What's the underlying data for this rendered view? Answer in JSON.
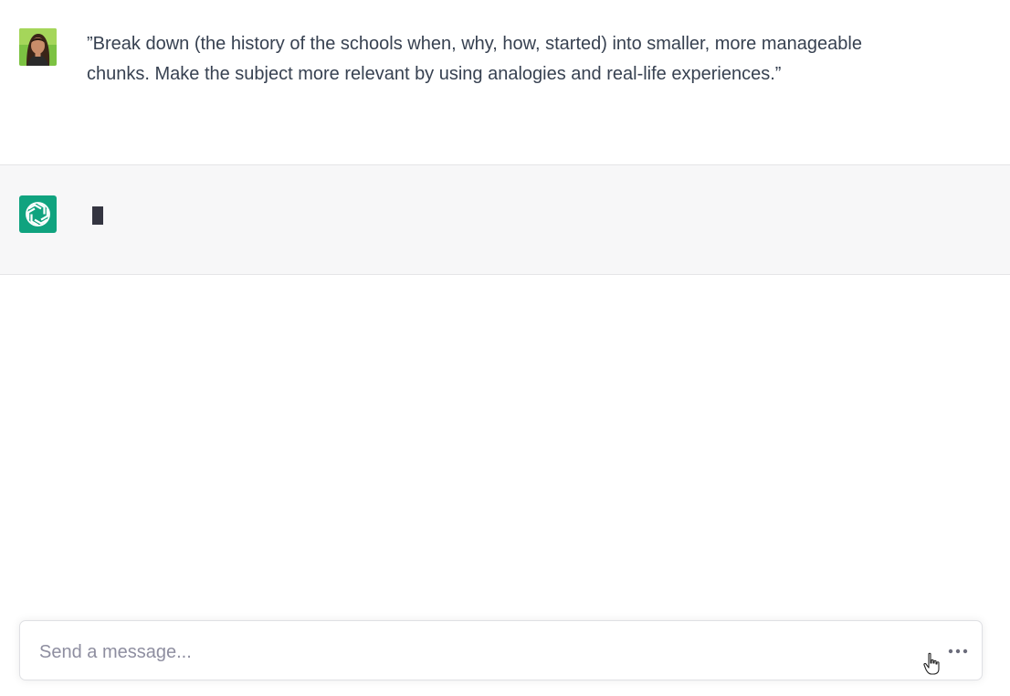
{
  "conversation": {
    "user_message": {
      "text": "”Break down (the history of the schools when, why, how, started) into smaller, more manageable chunks. Make the subject more relevant by using analogies and real-life experiences.”",
      "avatar_icon": "user-avatar-photo"
    },
    "assistant_message": {
      "text": "",
      "avatar_icon": "openai-logo-icon",
      "state": "typing-cursor"
    }
  },
  "composer": {
    "placeholder": "Send a message...",
    "value": "",
    "more_icon": "ellipsis-icon"
  },
  "colors": {
    "assistant_bg": "#f7f7f8",
    "logo_bg": "#10a37f",
    "text": "#374151",
    "placeholder": "#8e8ea0"
  }
}
